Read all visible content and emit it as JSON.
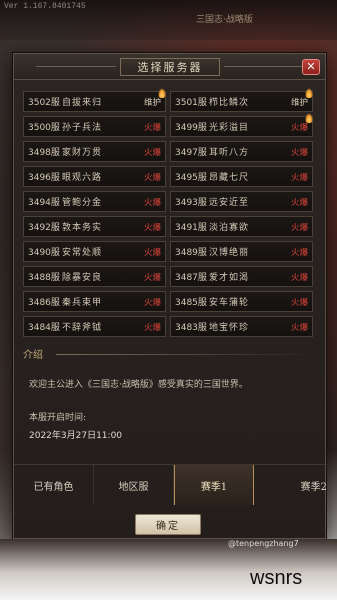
{
  "top": {
    "faded_id": "Ver 1.167.8401745",
    "faded_title": "三国志·战略版"
  },
  "dialog": {
    "title": "选择服务器",
    "close_glyph": "✕"
  },
  "servers": [
    {
      "id": "3502服",
      "name": "自拔来归",
      "status": "维护",
      "status_type": "maint",
      "flame": true
    },
    {
      "id": "3501服",
      "name": "栉比鳞次",
      "status": "维护",
      "status_type": "maint",
      "flame": true
    },
    {
      "id": "3500服",
      "name": "孙子兵法",
      "status": "火爆",
      "status_type": "hot",
      "flame": false
    },
    {
      "id": "3499服",
      "name": "光彩溢目",
      "status": "火爆",
      "status_type": "hot",
      "flame": true
    },
    {
      "id": "3498服",
      "name": "家财万贯",
      "status": "火爆",
      "status_type": "hot",
      "flame": false
    },
    {
      "id": "3497服",
      "name": "耳听八方",
      "status": "火爆",
      "status_type": "hot",
      "flame": false
    },
    {
      "id": "3496服",
      "name": "眼观六路",
      "status": "火爆",
      "status_type": "hot",
      "flame": false
    },
    {
      "id": "3495服",
      "name": "昂藏七尺",
      "status": "火爆",
      "status_type": "hot",
      "flame": false
    },
    {
      "id": "3494服",
      "name": "管鲍分金",
      "status": "火爆",
      "status_type": "hot",
      "flame": false
    },
    {
      "id": "3493服",
      "name": "远安近至",
      "status": "火爆",
      "status_type": "hot",
      "flame": false
    },
    {
      "id": "3492服",
      "name": "敦本务实",
      "status": "火爆",
      "status_type": "hot",
      "flame": false
    },
    {
      "id": "3491服",
      "name": "淡泊寡欲",
      "status": "火爆",
      "status_type": "hot",
      "flame": false
    },
    {
      "id": "3490服",
      "name": "安常处顺",
      "status": "火爆",
      "status_type": "hot",
      "flame": false
    },
    {
      "id": "3489服",
      "name": "汉博绝丽",
      "status": "火爆",
      "status_type": "hot",
      "flame": false
    },
    {
      "id": "3488服",
      "name": "除暴安良",
      "status": "火爆",
      "status_type": "hot",
      "flame": false
    },
    {
      "id": "3487服",
      "name": "爱才如渴",
      "status": "火爆",
      "status_type": "hot",
      "flame": false
    },
    {
      "id": "3486服",
      "name": "秦兵束甲",
      "status": "火爆",
      "status_type": "hot",
      "flame": false
    },
    {
      "id": "3485服",
      "name": "安车蒲轮",
      "status": "火爆",
      "status_type": "hot",
      "flame": false
    },
    {
      "id": "3484服",
      "name": "不辞斧钺",
      "status": "火爆",
      "status_type": "hot",
      "flame": false
    },
    {
      "id": "3483服",
      "name": "地宝怀珍",
      "status": "火爆",
      "status_type": "hot",
      "flame": false
    }
  ],
  "intro": {
    "heading": "介绍",
    "text": "欢迎主公进入《三国志·战略版》感受真实的三国世界。",
    "open_label": "本服开启时间:",
    "open_date": "2022年3月27日11:00"
  },
  "tabs": [
    {
      "label": "已有角色",
      "active": false
    },
    {
      "label": "地区服",
      "active": false
    },
    {
      "label": "赛季1",
      "active": true
    },
    {
      "label": "赛季2",
      "active": false
    }
  ],
  "confirm_label": "确定",
  "watermark": {
    "small": "@tenpengzhang7",
    "big": "wsnrs"
  }
}
